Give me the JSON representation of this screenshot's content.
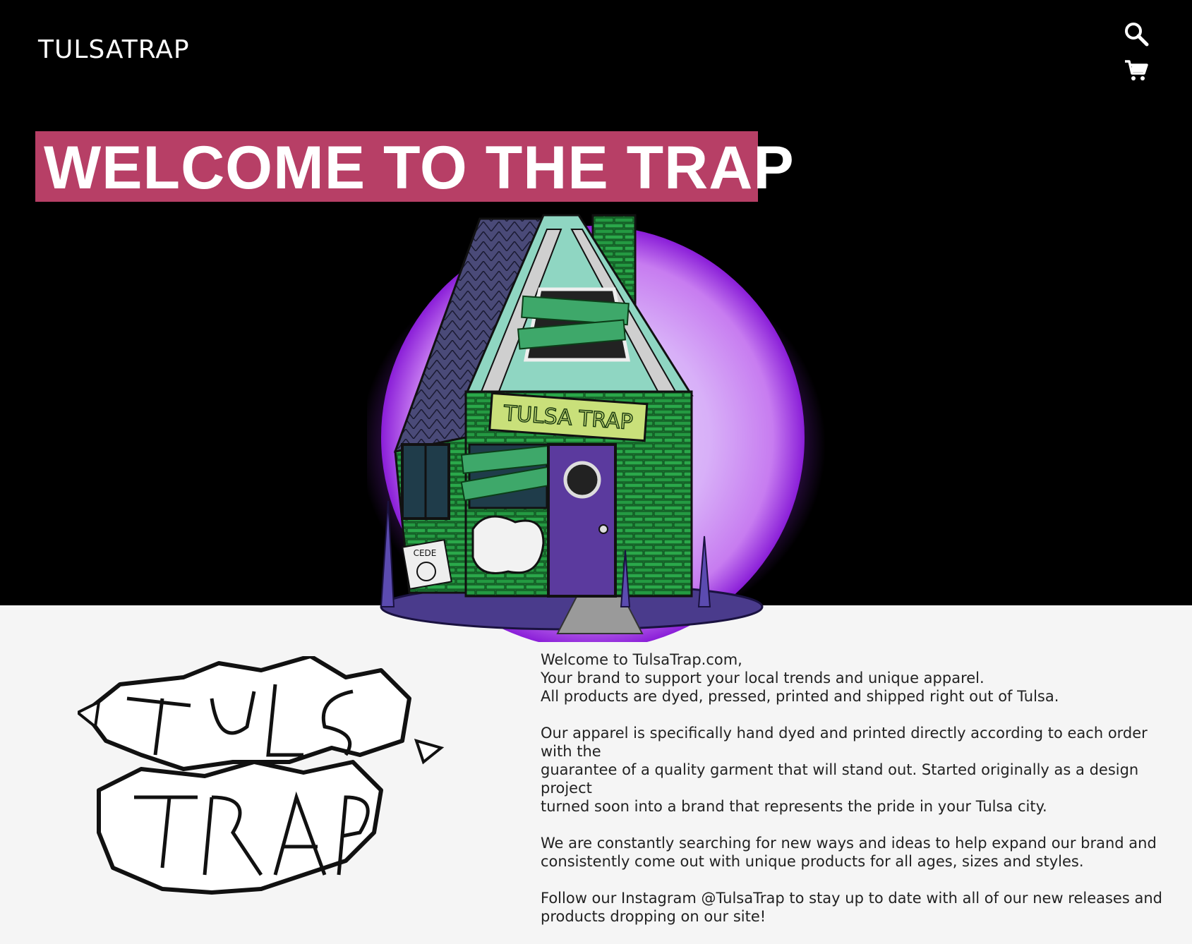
{
  "header": {
    "brand": "TULSATRAP",
    "icons": [
      "search-icon",
      "cart-icon"
    ]
  },
  "hero": {
    "banner_title": "WELCOME TO THE TRAP",
    "banner_color": "#b73f66",
    "sign_text": "TULSA TRAP",
    "sticker_text": "CEDE"
  },
  "about": {
    "paragraphs": [
      [
        "Welcome to TulsaTrap.com,",
        "Your brand to support your local trends and unique apparel.",
        "All products are dyed, pressed, printed and shipped right out of Tulsa."
      ],
      [
        "Our apparel is specifically hand dyed and printed directly according to each order with the",
        "guarantee of a quality garment that will stand out. Started originally as a design project",
        "turned soon into a brand that represents the pride in your Tulsa city."
      ],
      [
        "We are constantly searching for new ways and ideas to help expand our brand and",
        "consistently come out with unique products for all ages, sizes and styles."
      ],
      [
        "Follow our Instagram @TulsaTrap to stay up to date with all of our new releases and",
        "products dropping on our site!"
      ]
    ]
  },
  "colors": {
    "hero_bg": "#000000",
    "page_bg": "#f5f5f5",
    "glow": "#c98ef0"
  }
}
